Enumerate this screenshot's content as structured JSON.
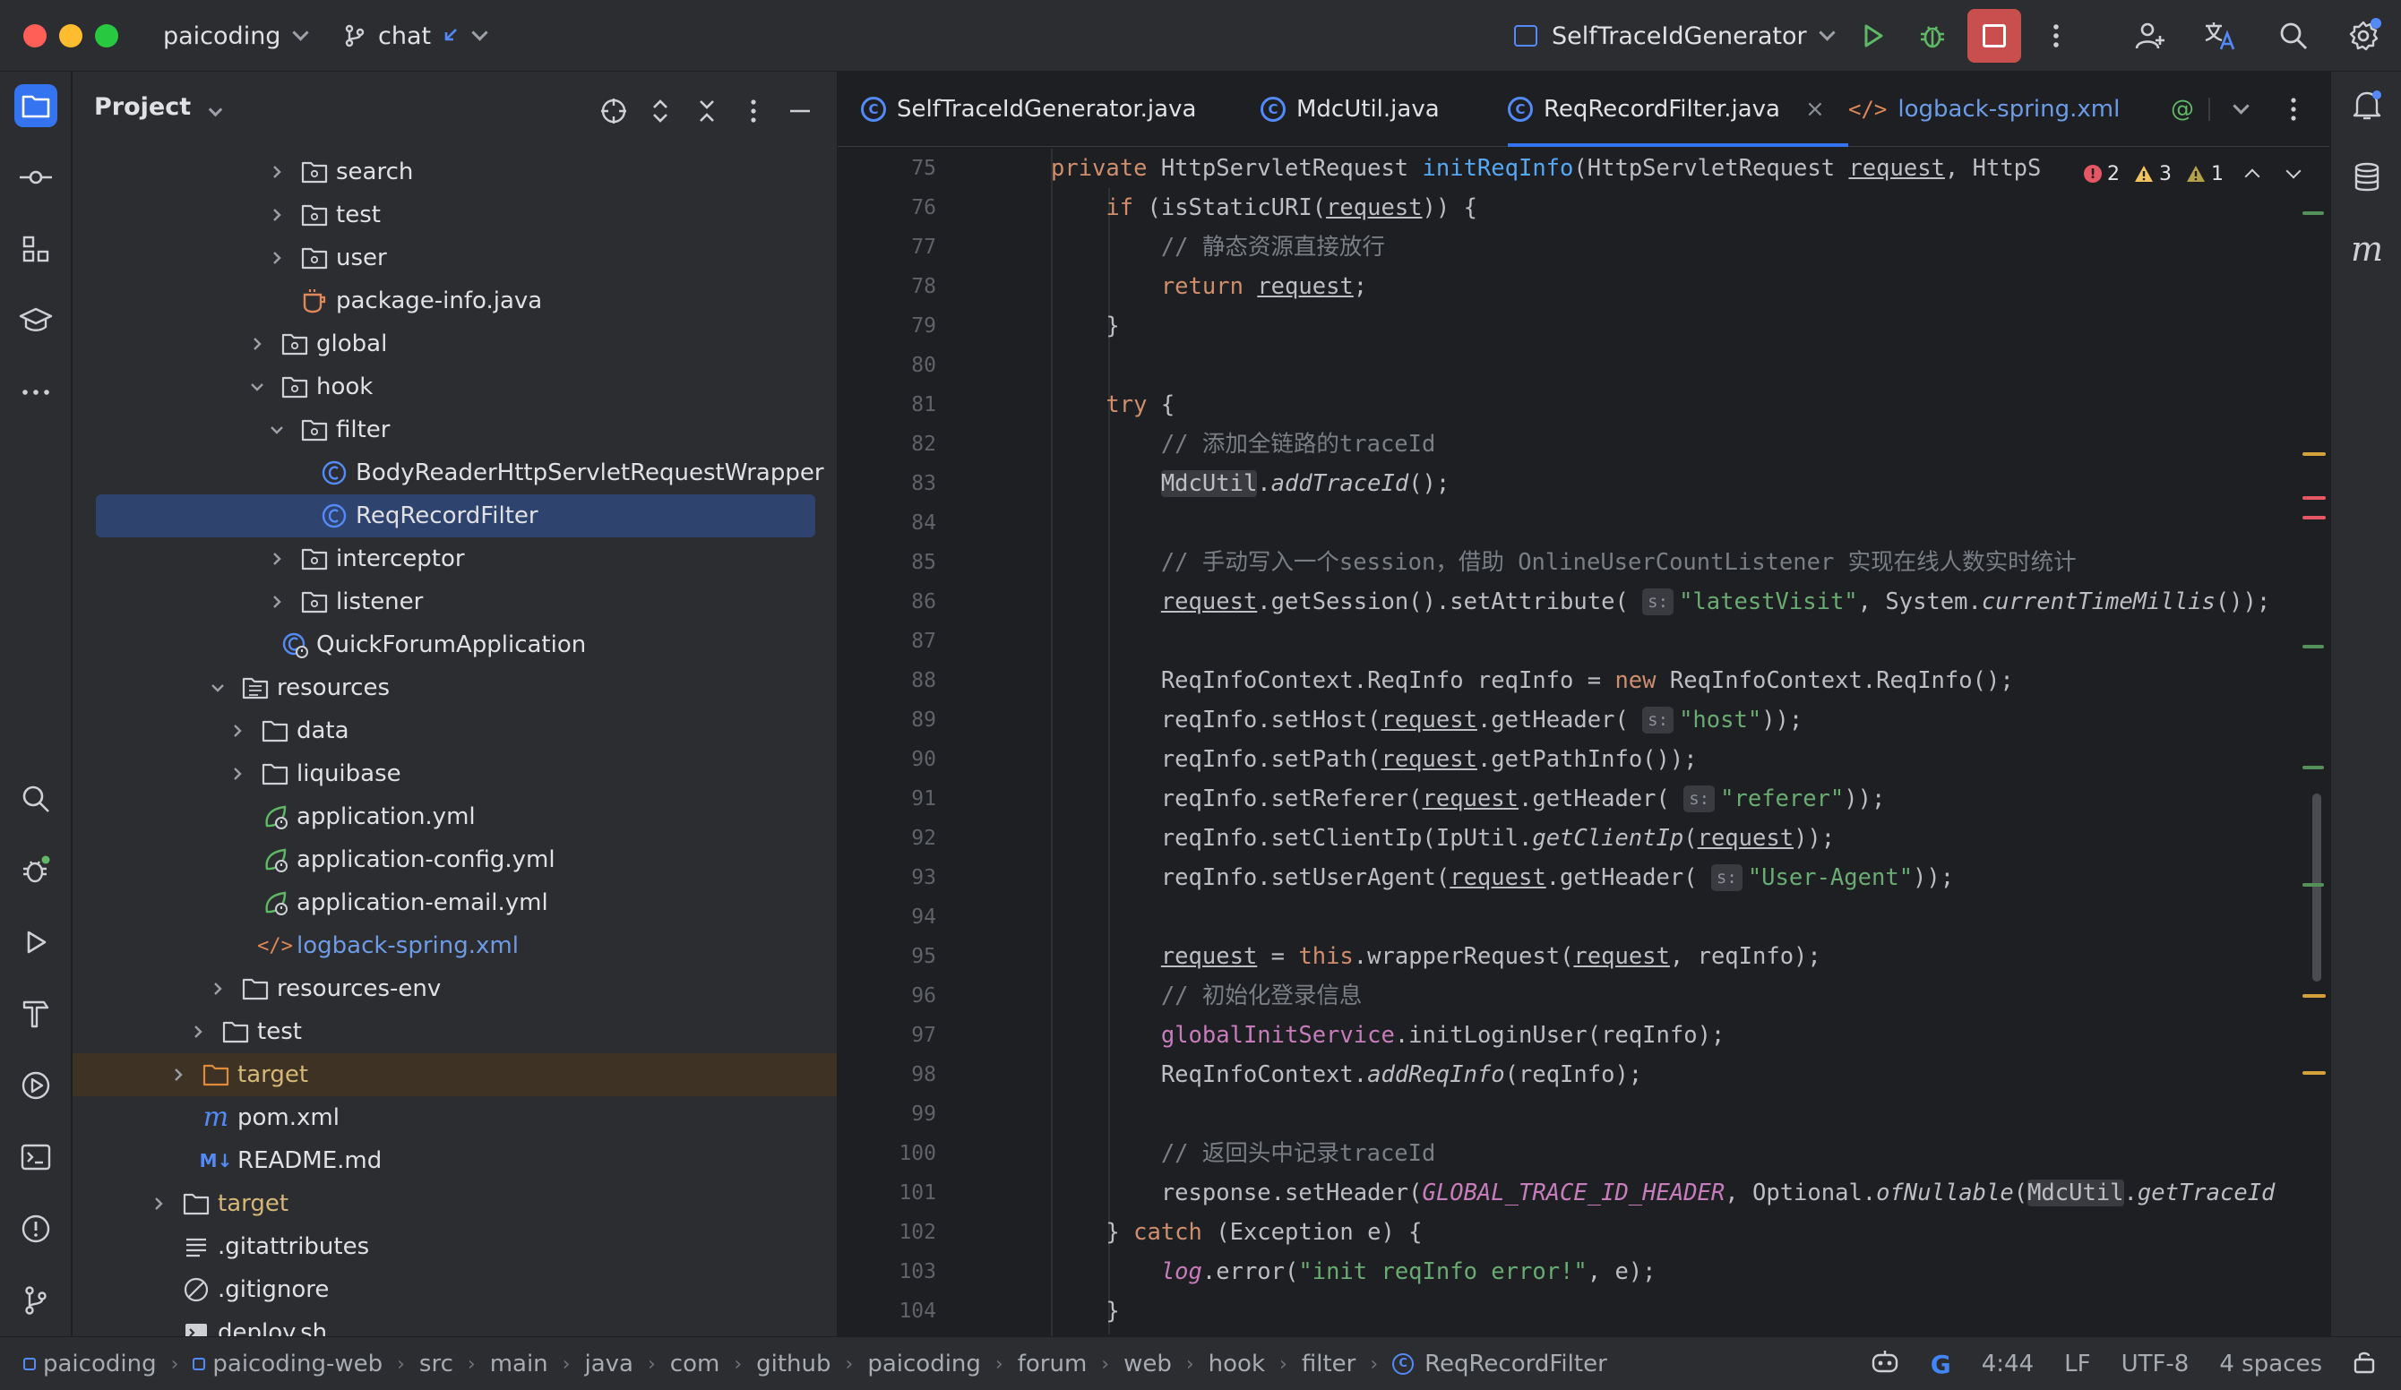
{
  "titlebar": {
    "project": "paicoding",
    "branch": "chat",
    "run_config": "SelfTraceIdGenerator"
  },
  "project_panel": {
    "title": "Project",
    "tree": [
      {
        "label": "search",
        "depth": 8,
        "kind": "folder",
        "expanded": false
      },
      {
        "label": "test",
        "depth": 8,
        "kind": "folder",
        "expanded": false
      },
      {
        "label": "user",
        "depth": 8,
        "kind": "folder",
        "expanded": false
      },
      {
        "label": "package-info.java",
        "depth": 8,
        "kind": "java-info",
        "expanded": null
      },
      {
        "label": "global",
        "depth": 7,
        "kind": "folder",
        "expanded": false
      },
      {
        "label": "hook",
        "depth": 7,
        "kind": "folder",
        "expanded": true
      },
      {
        "label": "filter",
        "depth": 8,
        "kind": "folder",
        "expanded": true
      },
      {
        "label": "BodyReaderHttpServletRequestWrapper",
        "depth": 9,
        "kind": "class",
        "expanded": null
      },
      {
        "label": "ReqRecordFilter",
        "depth": 9,
        "kind": "class",
        "expanded": null,
        "selected": true
      },
      {
        "label": "interceptor",
        "depth": 8,
        "kind": "folder",
        "expanded": false
      },
      {
        "label": "listener",
        "depth": 8,
        "kind": "folder",
        "expanded": false
      },
      {
        "label": "QuickForumApplication",
        "depth": 7,
        "kind": "app-class",
        "expanded": null
      },
      {
        "label": "resources",
        "depth": 5,
        "kind": "res-folder",
        "expanded": true
      },
      {
        "label": "data",
        "depth": 6,
        "kind": "plain-folder",
        "expanded": false
      },
      {
        "label": "liquibase",
        "depth": 6,
        "kind": "plain-folder",
        "expanded": false
      },
      {
        "label": "application.yml",
        "depth": 6,
        "kind": "yml",
        "expanded": null
      },
      {
        "label": "application-config.yml",
        "depth": 6,
        "kind": "yml",
        "expanded": null
      },
      {
        "label": "application-email.yml",
        "depth": 6,
        "kind": "yml",
        "expanded": null
      },
      {
        "label": "logback-spring.xml",
        "depth": 6,
        "kind": "xml",
        "expanded": null,
        "color": "blue"
      },
      {
        "label": "resources-env",
        "depth": 5,
        "kind": "plain-folder",
        "expanded": false
      },
      {
        "label": "test",
        "depth": 4,
        "kind": "plain-folder",
        "expanded": false
      },
      {
        "label": "target",
        "depth": 3,
        "kind": "excluded-folder",
        "expanded": false,
        "color": "yellow",
        "excluded": true
      },
      {
        "label": "pom.xml",
        "depth": 3,
        "kind": "maven",
        "expanded": null
      },
      {
        "label": "README.md",
        "depth": 3,
        "kind": "md",
        "expanded": null
      },
      {
        "label": "target",
        "depth": 2,
        "kind": "plain-folder",
        "expanded": false,
        "color": "yellow"
      },
      {
        "label": ".gitattributes",
        "depth": 2,
        "kind": "text",
        "expanded": null
      },
      {
        "label": ".gitignore",
        "depth": 2,
        "kind": "ignore",
        "expanded": null
      },
      {
        "label": "deploy.sh",
        "depth": 2,
        "kind": "shell",
        "expanded": null
      }
    ]
  },
  "editor": {
    "tabs": [
      {
        "label": "SelfTraceIdGenerator.java",
        "kind": "class"
      },
      {
        "label": "MdcUtil.java",
        "kind": "class"
      },
      {
        "label": "ReqRecordFilter.java",
        "kind": "class",
        "active": true
      },
      {
        "label": "logback-spring.xml",
        "kind": "xml"
      }
    ],
    "inspections": {
      "errors": "2",
      "warnings": "3",
      "weak_warnings": "1"
    },
    "line_numbers": [
      "75",
      "76",
      "77",
      "78",
      "79",
      "80",
      "81",
      "82",
      "83",
      "84",
      "85",
      "86",
      "87",
      "88",
      "89",
      "90",
      "91",
      "92",
      "93",
      "94",
      "95",
      "96",
      "97",
      "98",
      "99",
      "100",
      "101",
      "102",
      "103",
      "104"
    ]
  },
  "statusbar": {
    "breadcrumbs": [
      "paicoding",
      "paicoding-web",
      "src",
      "main",
      "java",
      "com",
      "github",
      "paicoding",
      "forum",
      "web",
      "hook",
      "filter",
      "ReqRecordFilter"
    ],
    "position": "4:44",
    "line_ending": "LF",
    "encoding": "UTF-8",
    "indent": "4 spaces"
  },
  "colors": {
    "accent": "#3574f0",
    "keyword": "#cf8e6d",
    "string": "#6aab73",
    "comment": "#7a7e85",
    "function": "#56a8f5"
  }
}
